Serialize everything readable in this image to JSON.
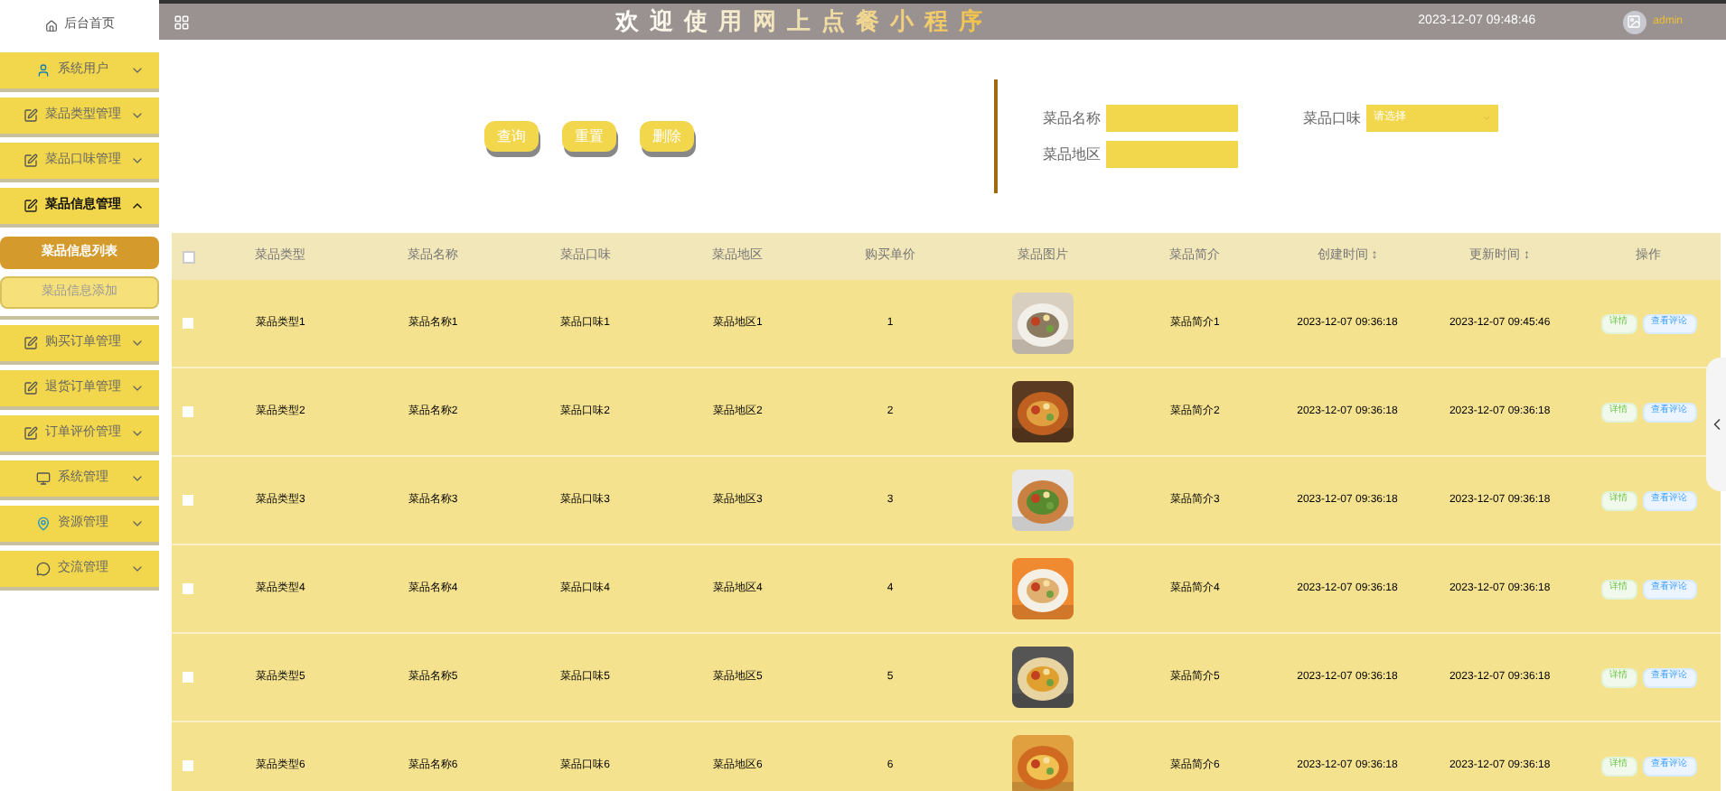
{
  "sidebar": {
    "home": "后台首页",
    "items": [
      {
        "label": "系统用户",
        "expanded": false
      },
      {
        "label": "菜品类型管理",
        "expanded": false
      },
      {
        "label": "菜品口味管理",
        "expanded": false
      },
      {
        "label": "菜品信息管理",
        "expanded": true,
        "children": [
          {
            "label": "菜品信息列表",
            "selected": true
          },
          {
            "label": "菜品信息添加",
            "selected": false
          }
        ]
      },
      {
        "label": "购买订单管理",
        "expanded": false
      },
      {
        "label": "退货订单管理",
        "expanded": false
      },
      {
        "label": "订单评价管理",
        "expanded": false
      },
      {
        "label": "系统管理",
        "expanded": false
      },
      {
        "label": "资源管理",
        "expanded": false
      },
      {
        "label": "交流管理",
        "expanded": false
      }
    ]
  },
  "header": {
    "title": "欢迎使用网上点餐小程序",
    "time": "2023-12-07 09:48:46",
    "user": "admin"
  },
  "toolbar": {
    "buttons": [
      "查询",
      "重置",
      "删除"
    ]
  },
  "search": {
    "fields": [
      {
        "label": "菜品名称",
        "kind": "input"
      },
      {
        "label": "菜品口味",
        "kind": "select",
        "placeholder": "请选择"
      },
      {
        "label": "菜品地区",
        "kind": "input"
      }
    ]
  },
  "table": {
    "select_all": {
      "checked": false
    },
    "columns": [
      "菜品类型",
      "菜品名称",
      "菜品口味",
      "菜品地区",
      "购买单价",
      "菜品图片",
      "菜品简介",
      "创建时间 ↕",
      "更新时间 ↕",
      "操作"
    ],
    "rows": [
      {
        "checked": false,
        "cells": [
          "菜品类型1",
          "菜品名称1",
          "菜品口味1",
          "菜品地区1",
          "1",
          {
            "kind": "picture"
          },
          "菜品简介1",
          "2023-12-07 09:36:18",
          "2023-12-07 09:45:46"
        ],
        "actions": [
          "详情",
          "查看评论"
        ]
      },
      {
        "checked": false,
        "cells": [
          "菜品类型2",
          "菜品名称2",
          "菜品口味2",
          "菜品地区2",
          "2",
          {
            "kind": "picture"
          },
          "菜品简介2",
          "2023-12-07 09:36:18",
          "2023-12-07 09:36:18"
        ],
        "actions": [
          "详情",
          "查看评论"
        ]
      },
      {
        "checked": false,
        "cells": [
          "菜品类型3",
          "菜品名称3",
          "菜品口味3",
          "菜品地区3",
          "3",
          {
            "kind": "picture"
          },
          "菜品简介3",
          "2023-12-07 09:36:18",
          "2023-12-07 09:36:18"
        ],
        "actions": [
          "详情",
          "查看评论"
        ]
      },
      {
        "checked": false,
        "cells": [
          "菜品类型4",
          "菜品名称4",
          "菜品口味4",
          "菜品地区4",
          "4",
          {
            "kind": "picture"
          },
          "菜品简介4",
          "2023-12-07 09:36:18",
          "2023-12-07 09:36:18"
        ],
        "actions": [
          "详情",
          "查看评论"
        ]
      },
      {
        "checked": false,
        "cells": [
          "菜品类型5",
          "菜品名称5",
          "菜品口味5",
          "菜品地区5",
          "5",
          {
            "kind": "picture"
          },
          "菜品简介5",
          "2023-12-07 09:36:18",
          "2023-12-07 09:36:18"
        ],
        "actions": [
          "详情",
          "查看评论"
        ]
      },
      {
        "checked": false,
        "cells": [
          "菜品类型6",
          "菜品名称6",
          "菜品口味6",
          "菜品地区6",
          "6",
          {
            "kind": "picture"
          },
          "菜品简介6",
          "2023-12-07 09:36:18",
          "2023-12-07 09:36:18"
        ],
        "actions": [
          "详情",
          "查看评论"
        ]
      }
    ]
  }
}
